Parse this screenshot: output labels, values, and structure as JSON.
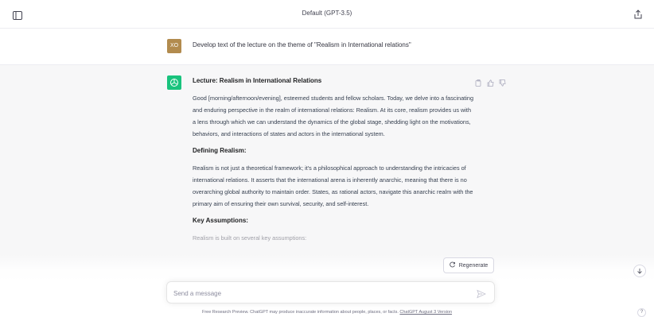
{
  "header": {
    "model_title": "Default (GPT-3.5)",
    "sidebar_icon": "sidebar-toggle-icon",
    "share_icon": "share-icon"
  },
  "user_message": {
    "avatar_initials": "XO",
    "text": "Develop text of the lecture on the theme of \"Realism in International relations\""
  },
  "assistant_message": {
    "title": "Lecture: Realism in International Relations",
    "intro": "Good [morning/afternoon/evening], esteemed students and fellow scholars. Today, we delve into a fascinating and enduring perspective in the realm of international relations: Realism. At its core, realism provides us with a lens through which we can understand the dynamics of the global stage, shedding light on the motivations, behaviors, and interactions of states and actors in the international system.",
    "section1_heading": "Defining Realism:",
    "section1_text": "Realism is not just a theoretical framework; it's a philosophical approach to understanding the intricacies of international relations. It asserts that the international arena is inherently anarchic, meaning that there is no overarching global authority to maintain order. States, as rational actors, navigate this anarchic realm with the primary aim of ensuring their own survival, security, and self-interest.",
    "section2_heading": "Key Assumptions:",
    "section2_text": "Realism is built on several key assumptions:",
    "actions": [
      "copy-icon",
      "thumbs-up-icon",
      "thumbs-down-icon"
    ]
  },
  "regenerate_label": "Regenerate",
  "composer": {
    "placeholder": "Send a message"
  },
  "footer": {
    "text": "Free Research Preview. ChatGPT may produce inaccurate information about people, places, or facts. ",
    "link": "ChatGPT August 3 Version"
  },
  "help_label": "?",
  "colors": {
    "assistant_avatar": "#19c37d",
    "user_avatar": "#b28b4e",
    "assistant_bg": "#f7f7f8"
  }
}
